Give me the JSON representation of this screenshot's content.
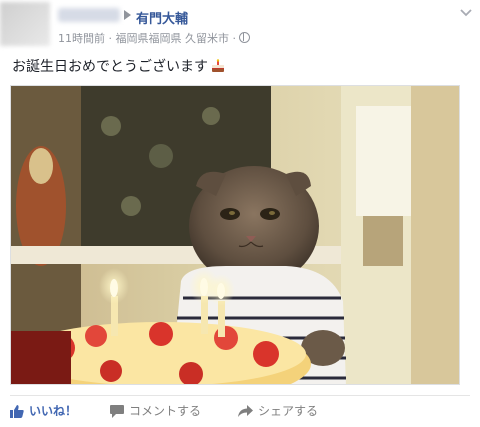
{
  "post": {
    "target_name": "有門大輔",
    "meta": "11時間前 · 福岡県福岡県 久留米市 ·",
    "message": "お誕生日おめでとうございます",
    "message_emoji": "cake-icon",
    "photo": "cat-with-birthday-cake-photo"
  },
  "actions": {
    "like": "いいね！",
    "comment": "コメントする",
    "share": "シェアする"
  },
  "colors": {
    "link": "#365899",
    "meta": "#90949c",
    "like_blue": "#4267b2",
    "action_gray": "#7f7f7f"
  }
}
